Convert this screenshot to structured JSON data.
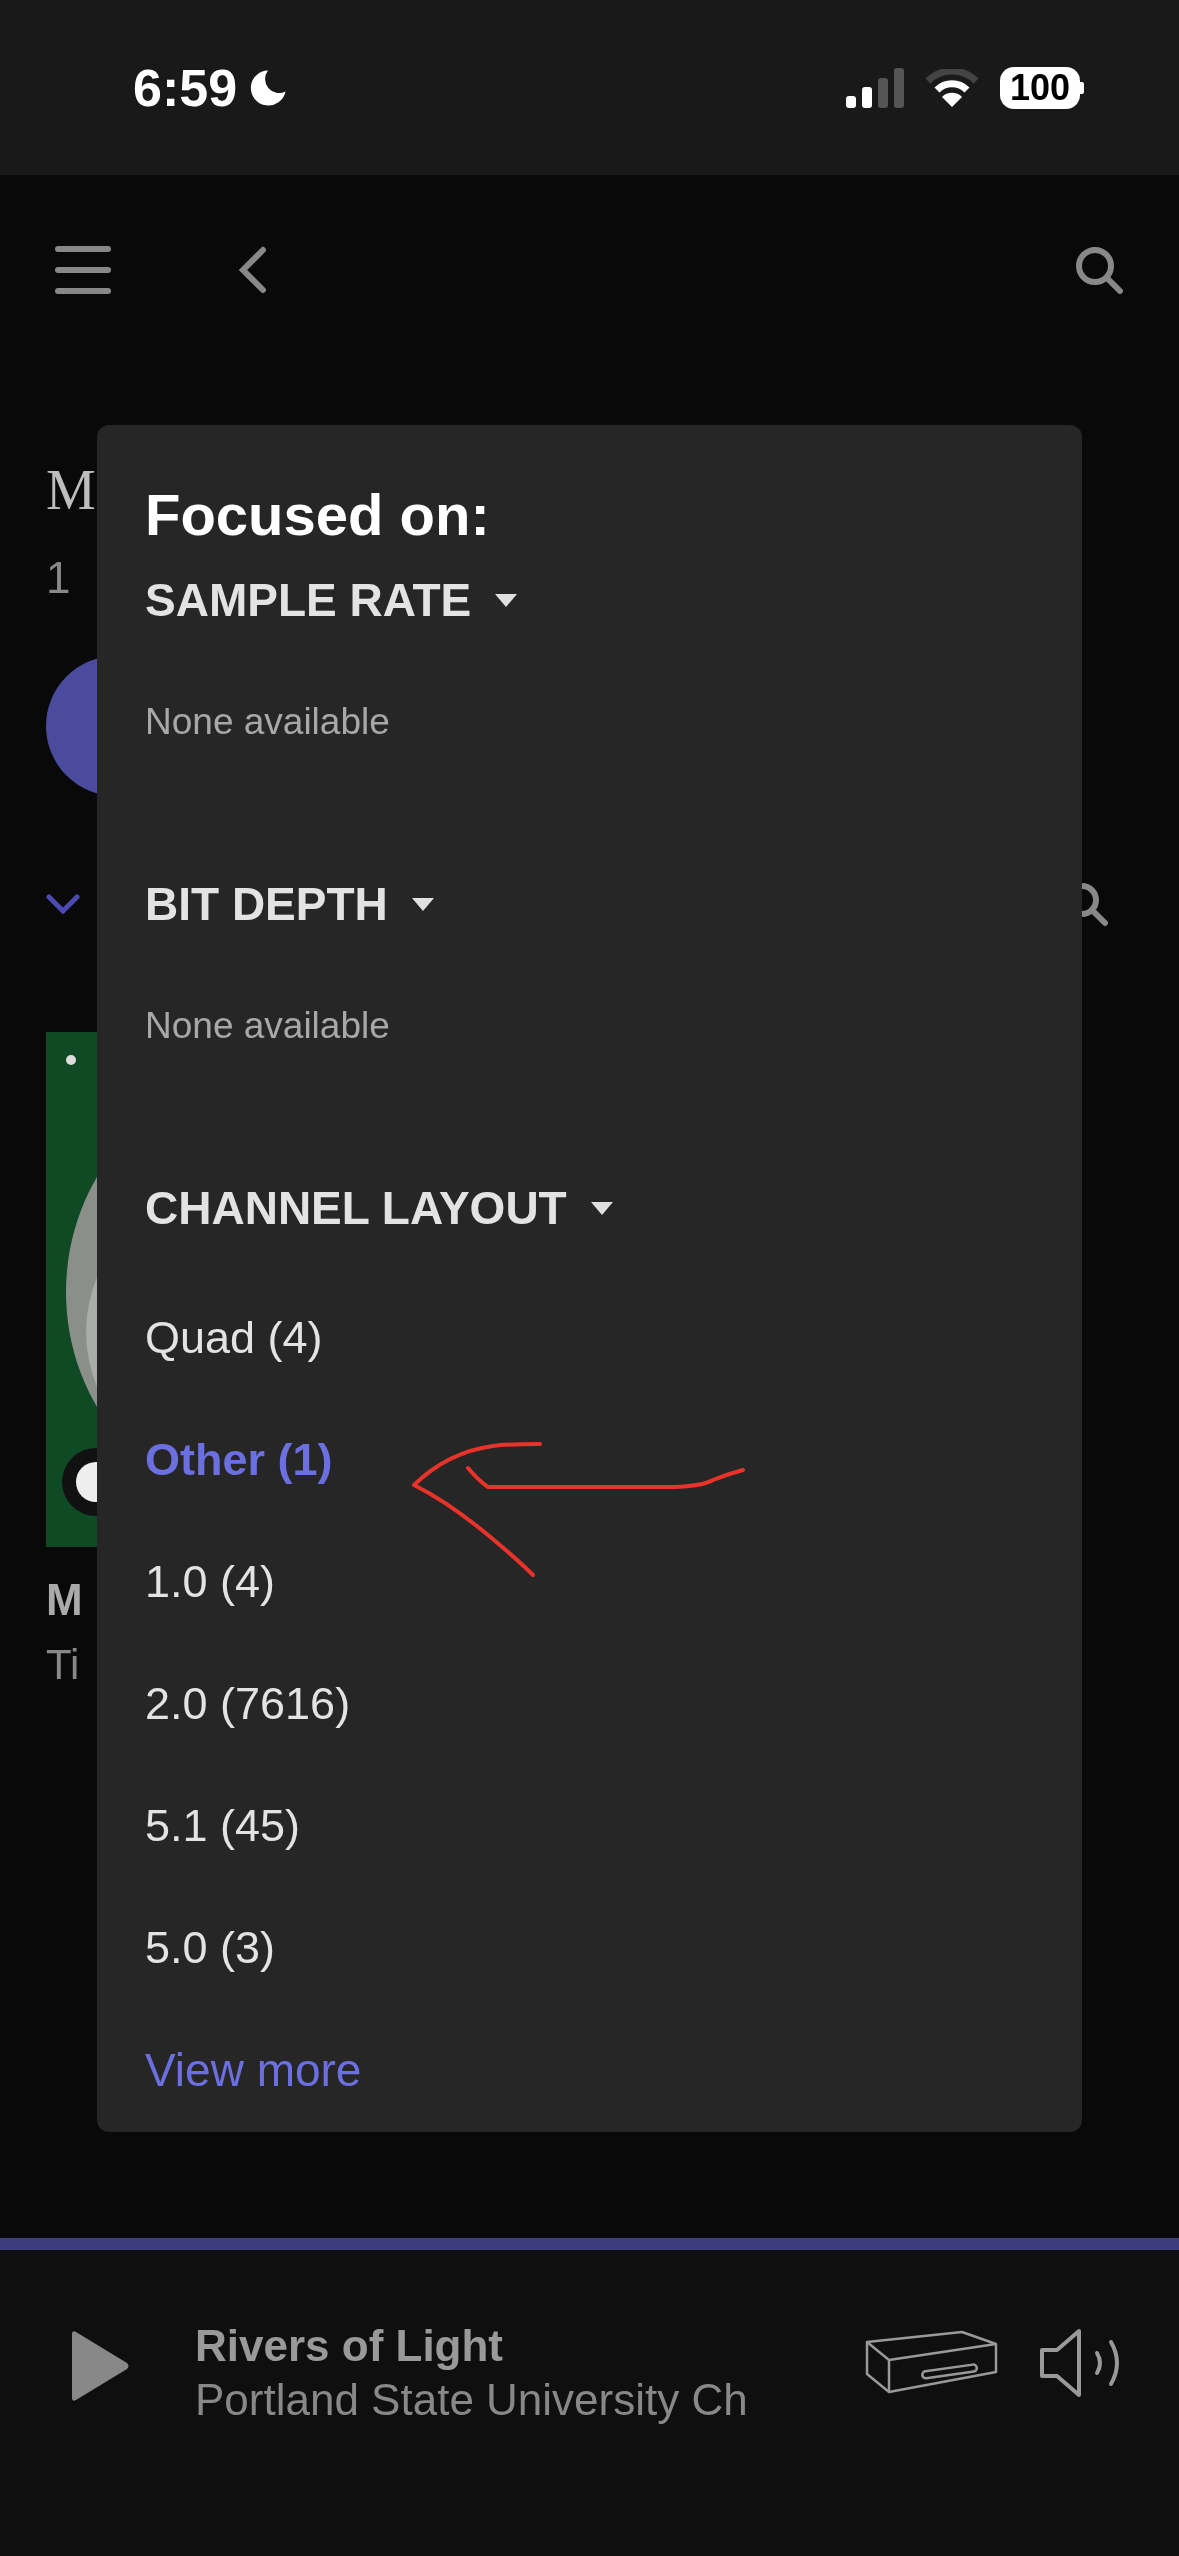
{
  "status_bar": {
    "time": "6:59",
    "battery": "100"
  },
  "background": {
    "title": "M",
    "subtitle": "1",
    "album": {
      "title": "M",
      "artist": "Ti"
    }
  },
  "filter_panel": {
    "title": "Focused on:",
    "sections": [
      {
        "heading": "SAMPLE RATE",
        "empty_text": "None available"
      },
      {
        "heading": "BIT DEPTH",
        "empty_text": "None available"
      },
      {
        "heading": "CHANNEL LAYOUT",
        "options": [
          {
            "label": "Quad (4)",
            "selected": false
          },
          {
            "label": "Other (1)",
            "selected": true
          },
          {
            "label": "1.0 (4)",
            "selected": false
          },
          {
            "label": "2.0 (7616)",
            "selected": false
          },
          {
            "label": "5.1 (45)",
            "selected": false
          },
          {
            "label": "5.0 (3)",
            "selected": false
          }
        ]
      }
    ],
    "view_more": "View more"
  },
  "now_playing": {
    "title": "Rivers of Light",
    "artist": "Portland State University Ch"
  }
}
